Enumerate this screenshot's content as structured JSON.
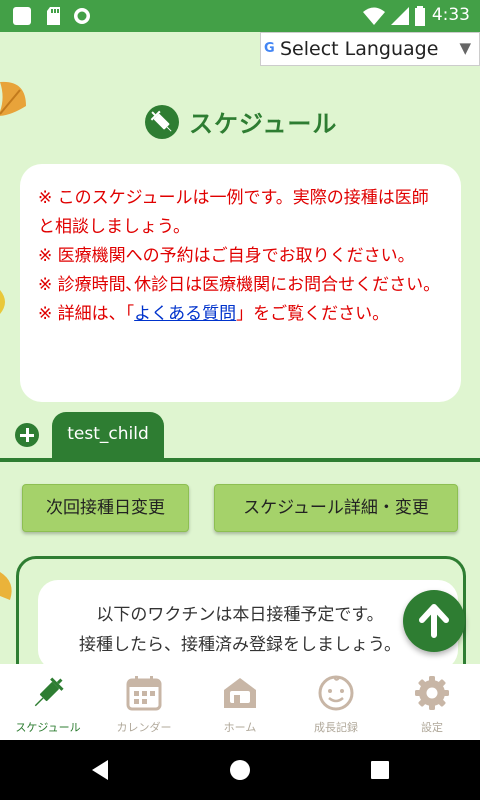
{
  "status_bar": {
    "time": "4:33",
    "color": "#43a047",
    "left_icons": [
      "app-icon",
      "sd-card-icon",
      "sync-icon"
    ],
    "right_icons": [
      "wifi-icon",
      "cellular-signal-icon",
      "battery-icon"
    ]
  },
  "language_select": {
    "label": "Select Language",
    "icon": "google-g-icon"
  },
  "header": {
    "title": "スケジュール",
    "icon": "syringe-icon"
  },
  "notice": {
    "line1": "※ このスケジュールは一例です。実際の接種は医師と相談しましょう。",
    "line2": "※ 医療機関への予約はご自身でお取りください。",
    "line3": "※ 診療時間､休診日は医療機関にお問合せください。",
    "line4_prefix": "※ 詳細は、「",
    "line4_link": "よくある質問",
    "line4_suffix": "」をご覧ください。",
    "text_color": "#e00000"
  },
  "child_tabs": {
    "add_icon": "plus-circle-icon",
    "tabs": [
      {
        "label": "test_child"
      }
    ]
  },
  "actions": {
    "next_date_label": "次回接種日変更",
    "schedule_edit_label": "スケジュール詳細・変更"
  },
  "today_panel": {
    "line1": "以下のワクチンは本日接種予定です。",
    "line2": "接種したら、接種済み登録をしましょう。"
  },
  "scroll_top": {
    "icon": "arrow-up-icon"
  },
  "bottom_nav": {
    "items": [
      {
        "label": "スケジュール",
        "icon": "syringe-icon",
        "active": true
      },
      {
        "label": "カレンダー",
        "icon": "calendar-icon",
        "active": false
      },
      {
        "label": "ホーム",
        "icon": "home-icon",
        "active": false
      },
      {
        "label": "成長記録",
        "icon": "baby-face-icon",
        "active": false
      },
      {
        "label": "設定",
        "icon": "gear-icon",
        "active": false
      }
    ],
    "active_color": "#2e7d32",
    "inactive_color": "#b0a89a"
  },
  "theme": {
    "background": "#dff5d0",
    "primary": "#2e7d32",
    "button": "#a5d26a"
  }
}
